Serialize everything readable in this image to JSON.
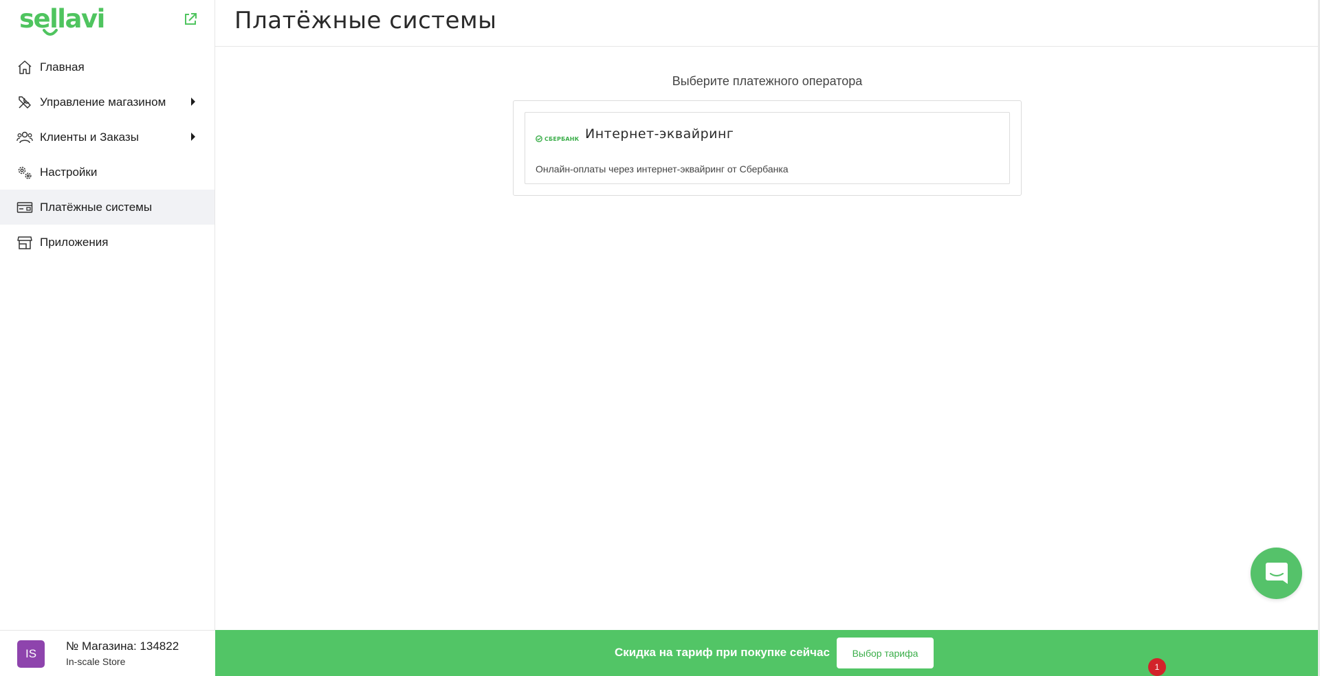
{
  "brand": {
    "logo_text": "sellavi",
    "accent_color": "#4fc45f"
  },
  "sidebar": {
    "items": [
      {
        "label": "Главная",
        "icon": "home-icon",
        "has_submenu": false,
        "active": false
      },
      {
        "label": "Управление магазином",
        "icon": "tools-icon",
        "has_submenu": true,
        "active": false
      },
      {
        "label": "Клиенты и Заказы",
        "icon": "users-icon",
        "has_submenu": true,
        "active": false
      },
      {
        "label": "Настройки",
        "icon": "gears-icon",
        "has_submenu": false,
        "active": false
      },
      {
        "label": "Платёжные системы",
        "icon": "payment-card-icon",
        "has_submenu": false,
        "active": true
      },
      {
        "label": "Приложения",
        "icon": "store-icon",
        "has_submenu": false,
        "active": false
      }
    ]
  },
  "store": {
    "avatar_initials": "IS",
    "avatar_color": "#8e44ad",
    "number_label": "№ Магазина: 134822",
    "name": "In-scale Store"
  },
  "header": {
    "title": "Платёжные системы"
  },
  "main": {
    "section_label": "Выберите платежного оператора",
    "operators": [
      {
        "logo_text": "СБЕРБАНК",
        "title": "Интернет-эквайринг",
        "description": "Онлайн-оплаты через интернет-эквайринг от Сбербанка"
      }
    ]
  },
  "promo": {
    "text": "Скидка на тариф при покупке сейчас",
    "button_label": "Выбор тарифа",
    "bar_color": "#52c566"
  },
  "notifications": {
    "count": "1"
  }
}
